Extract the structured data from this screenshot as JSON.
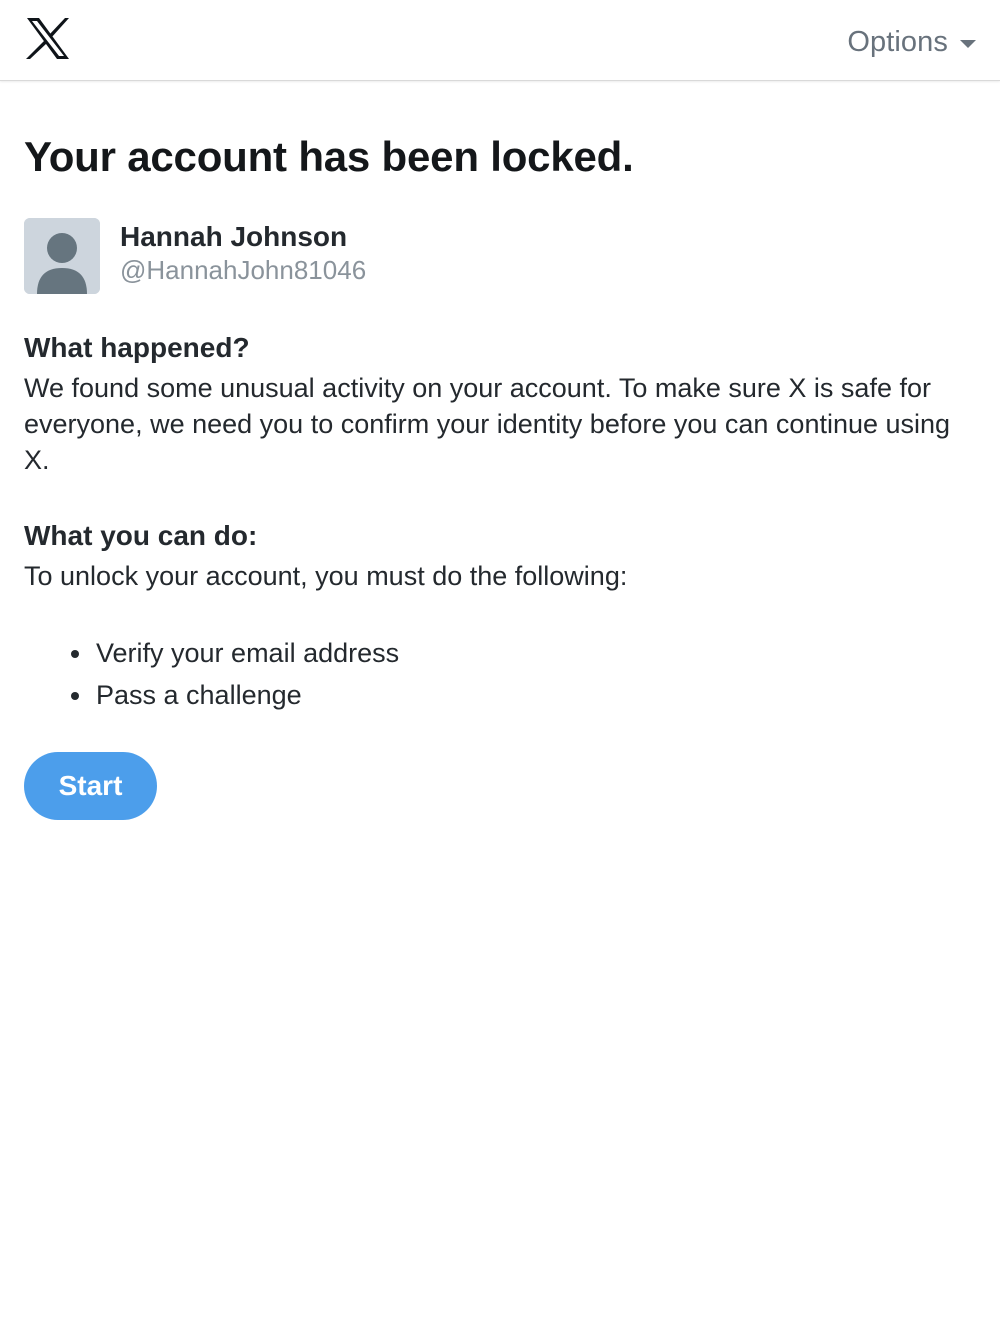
{
  "header": {
    "logo_icon": "x-logo-icon",
    "options_label": "Options",
    "options_icon": "caret-down-icon"
  },
  "page": {
    "title": "Your account has been locked."
  },
  "user": {
    "name": "Hannah Johnson",
    "handle": "@HannahJohn81046",
    "avatar_icon": "default-avatar-icon"
  },
  "what_happened": {
    "heading": "What happened?",
    "text": "We found some unusual activity on your account. To make sure X is safe for everyone, we need you to confirm your identity before you can continue using X."
  },
  "what_you_can_do": {
    "heading": "What you can do:",
    "text": "To unlock your account, you must do the following:",
    "steps": [
      {
        "label": "Verify your email address"
      },
      {
        "label": "Pass a challenge"
      }
    ]
  },
  "actions": {
    "start_label": "Start"
  },
  "colors": {
    "accent": "#4c9eeb",
    "text": "#24292e",
    "muted": "#8a939b"
  }
}
